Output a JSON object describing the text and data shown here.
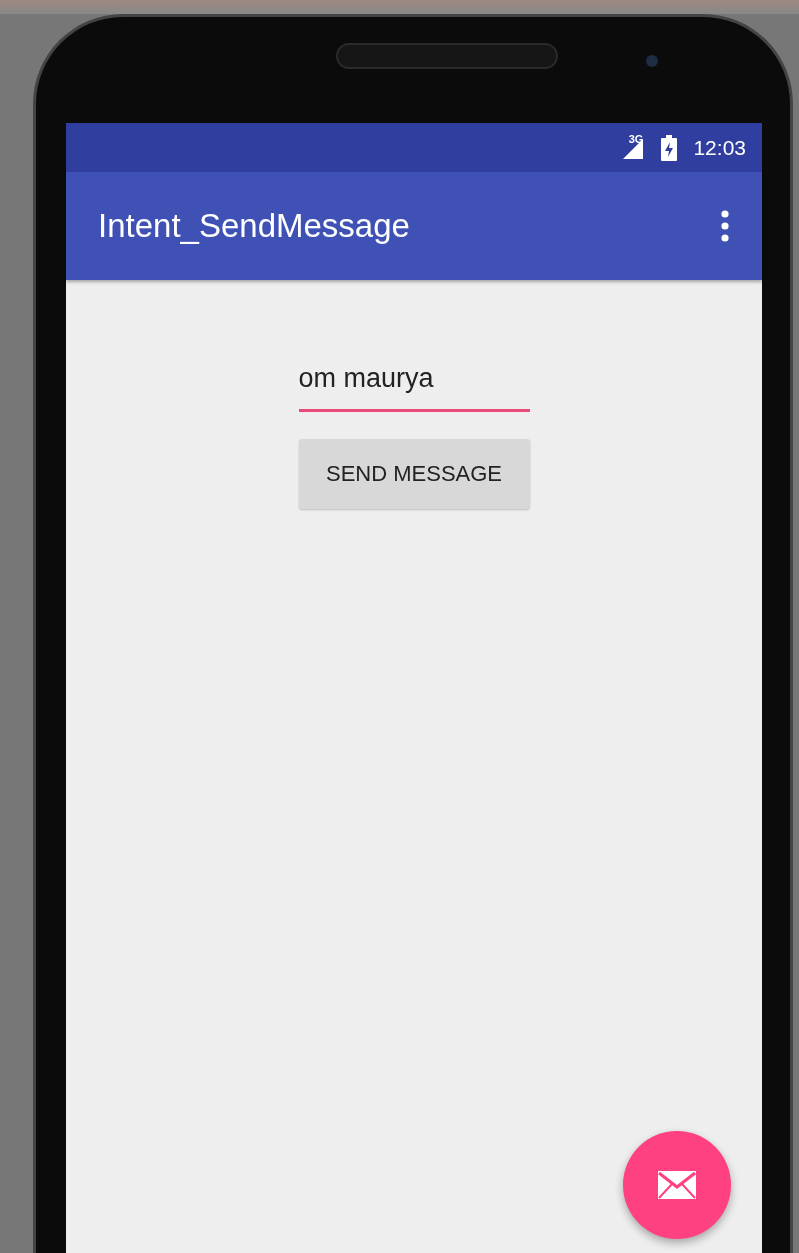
{
  "status_bar": {
    "network": "3G",
    "time": "12:03"
  },
  "app_bar": {
    "title": "Intent_SendMessage"
  },
  "message_field": {
    "value": "om maurya",
    "focused": true
  },
  "send_button": {
    "label": "SEND MESSAGE"
  },
  "fab": {
    "kind": "mail"
  }
}
